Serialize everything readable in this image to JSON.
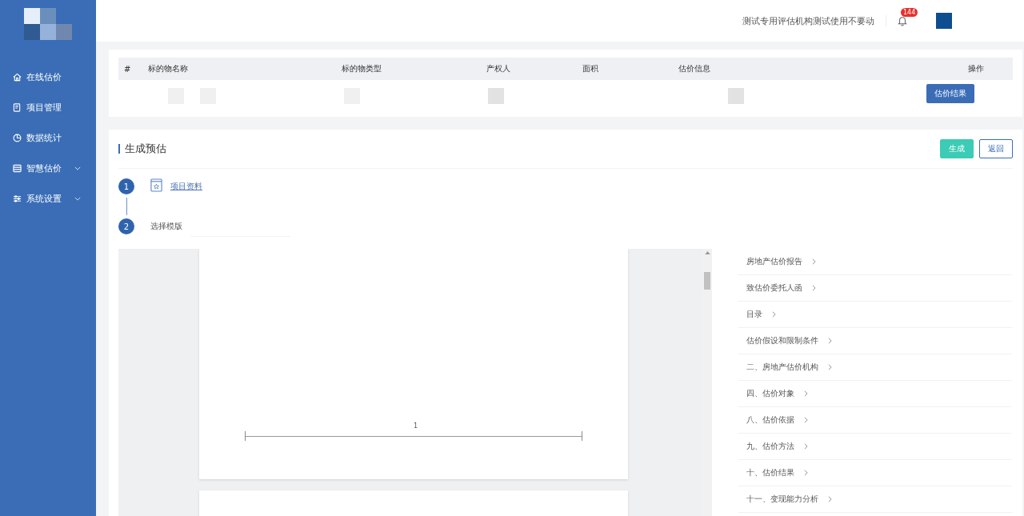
{
  "sidebar": {
    "items": [
      {
        "label": "在线估价",
        "kind": "link"
      },
      {
        "label": "项目管理",
        "kind": "link"
      },
      {
        "label": "数据统计",
        "kind": "link"
      },
      {
        "label": "智慧估价",
        "kind": "submenu"
      },
      {
        "label": "系统设置",
        "kind": "submenu"
      }
    ]
  },
  "header": {
    "org_name": "测试专用评估机构测试使用不要动",
    "notification_count": "144"
  },
  "table": {
    "columns": [
      "#",
      "标的物名称",
      "标的物类型",
      "产权人",
      "面积",
      "估价信息",
      "操作"
    ],
    "rows": [
      {
        "action": "估价结果"
      }
    ]
  },
  "section": {
    "title": "生成预估",
    "buttons": [
      {
        "label": "生成",
        "kind": "primary"
      },
      {
        "label": "返回",
        "kind": "outline"
      }
    ],
    "steps": [
      {
        "number": "1",
        "label": "项目资料",
        "kind": "link"
      },
      {
        "number": "2",
        "label": "选择模版",
        "kind": "select"
      }
    ]
  },
  "preview": {
    "line_label": "1"
  },
  "outline": [
    "房地产估价报告",
    "致估价委托人函",
    "目录",
    "估价假设和限制条件",
    "二、房地产估价机构",
    "四、估价对象",
    "八、估价依据",
    "九、估价方法",
    "十、估价结果",
    "十一、变现能力分析"
  ]
}
